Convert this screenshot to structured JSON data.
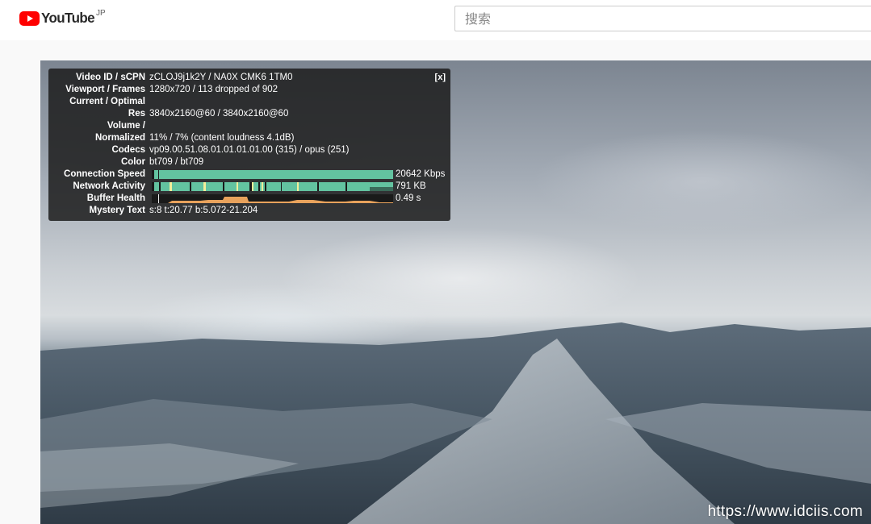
{
  "header": {
    "logo_text": "YouTube",
    "region": "JP",
    "search_placeholder": "搜索"
  },
  "stats": {
    "close_label": "[x]",
    "rows": [
      {
        "label": "Video ID / sCPN",
        "value": "zCLOJ9j1k2Y / NA0X CMK6 1TM0"
      },
      {
        "label": "Viewport / Frames",
        "value": "1280x720 / 113 dropped of 902"
      },
      {
        "label": "Current / Optimal",
        "value": ""
      },
      {
        "label": "Res",
        "value": "3840x2160@60 / 3840x2160@60"
      },
      {
        "label": "Volume /",
        "value": ""
      },
      {
        "label": "Normalized",
        "value": "11% / 7% (content loudness 4.1dB)"
      },
      {
        "label": "Codecs",
        "value": "vp09.00.51.08.01.01.01.01.00 (315) / opus (251)"
      },
      {
        "label": "Color",
        "value": "bt709 / bt709"
      },
      {
        "label": "Connection Speed",
        "value": "20642 Kbps"
      },
      {
        "label": "Network Activity",
        "value": "791 KB"
      },
      {
        "label": "Buffer Health",
        "value": "0.49 s"
      },
      {
        "label": "Mystery Text",
        "value": "s:8 t:20.77 b:5.072-21.204"
      }
    ]
  },
  "watermark": "https://www.idciis.com",
  "colors": {
    "brand_red": "#ff0000",
    "graph_green": "#63c3a0",
    "graph_yellow": "#f3ef9a",
    "buffer_orange": "#e8a25c"
  }
}
